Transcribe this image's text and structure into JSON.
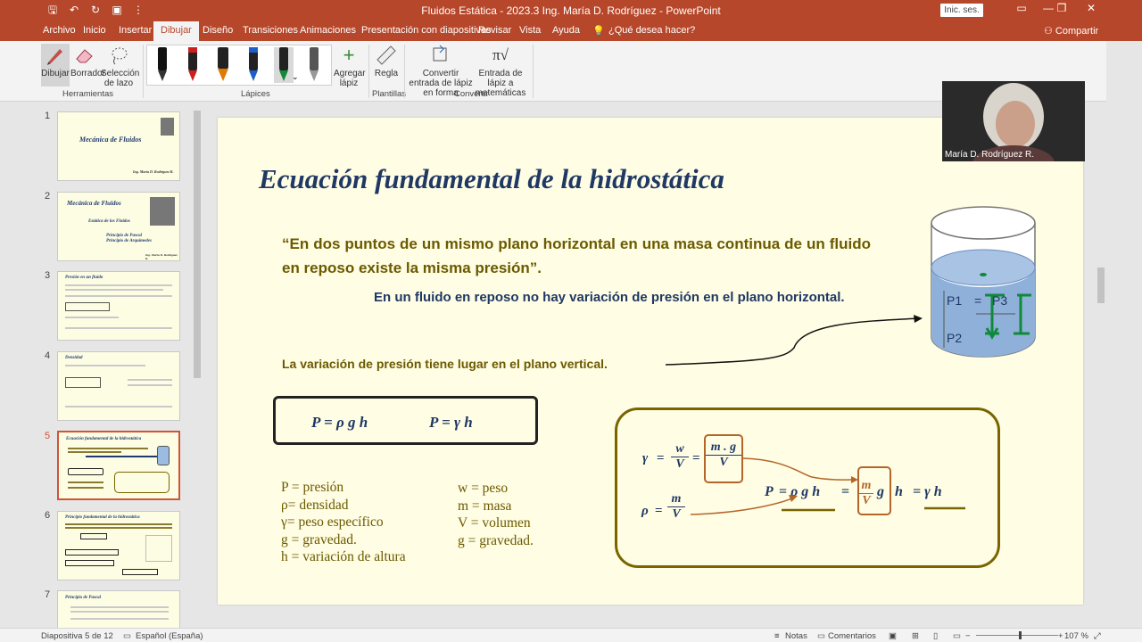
{
  "window": {
    "doc_title": "Fluidos Estática  - 2023.3 Ing. María D. Rodríguez  -  PowerPoint",
    "sign_in": "Inic. ses.",
    "minimize": "—",
    "restore": "❐",
    "close": "✕"
  },
  "tabs": [
    "Archivo",
    "Inicio",
    "Insertar",
    "Dibujar",
    "Diseño",
    "Transiciones",
    "Animaciones",
    "Presentación con diapositivas",
    "Revisar",
    "Vista",
    "Ayuda",
    "¿Qué desea hacer?"
  ],
  "active_tab": "Dibujar",
  "share": "Compartir",
  "ribbon": {
    "dibujar": "Dibujar",
    "borrador": "Borrador",
    "seleccion": "Selección de lazo",
    "group_herramientas": "Herramientas",
    "agregar_lapiz": "Agregar lápiz",
    "group_lapices": "Lápices",
    "regla": "Regla",
    "group_plantillas": "Plantillas",
    "convertir_forma": "Convertir entrada de lápiz en forma",
    "entrada_matematicas": "Entrada de lápiz a matemáticas",
    "group_convertir": "Convertir",
    "pen_colors": [
      "#111111",
      "#cc1f1f",
      "#e07b00",
      "#1c5fc6",
      "#0f8a3a",
      "#777777"
    ]
  },
  "thumbnails": [
    {
      "num": "1",
      "title": "Mecánica de Fluidos",
      "author": "Ing. María D. Rodríguez R."
    },
    {
      "num": "2",
      "title": "Mecánica de Fluidos",
      "subtitle": "Estática de los Fluidos",
      "b1": "Principio de Pascal",
      "b2": "Principio de Arquímedes",
      "author": "Ing. María D. Rodríguez R."
    },
    {
      "num": "3",
      "title": "Presión en un fluido"
    },
    {
      "num": "4",
      "title": "Densidad"
    },
    {
      "num": "5",
      "title": "Ecuación fundamental de la hidrostática"
    },
    {
      "num": "6",
      "title": "Principio fundamental de la hidrostática"
    },
    {
      "num": "7",
      "title": "Principio de Pascal"
    }
  ],
  "slide": {
    "title": "Ecuación fundamental de la hidrostática",
    "quote": "“En dos puntos de un mismo plano horizontal en una masa continua de un fluido en reposo existe la misma presión”.",
    "sub1": "En un fluido en reposo no hay variación de presión en el plano horizontal.",
    "sub2": "La variación de presión tiene lugar en el plano vertical.",
    "eq1": "P =  ρ g h",
    "eq2": "P =  γ  h",
    "legend_left": [
      "P = presión",
      "ρ= densidad",
      "γ= peso  específico",
      "g = gravedad.",
      "h = variación de altura"
    ],
    "legend_right": [
      "w = peso",
      "m = masa",
      "V = volumen",
      "g = gravedad."
    ],
    "p1": "P1",
    "eq_sign": "=",
    "p3": "P3",
    "p2": "P2",
    "gamma": "γ",
    "rho": "ρ",
    "eq": "=",
    "w": "w",
    "V": "V",
    "mg": "m . g",
    "m": "m",
    "final_P": "P",
    "final_rho_g_h": "ρ g h",
    "final_g": "g",
    "final_h": "h",
    "final_eq2": "= γ  h"
  },
  "camera": {
    "name": "María D. Rodríguez R."
  },
  "status": {
    "slide": "Diapositiva 5 de 12",
    "lang": "Español (España)",
    "notes": "Notas",
    "comments": "Comentarios",
    "zoom": "107 %"
  }
}
